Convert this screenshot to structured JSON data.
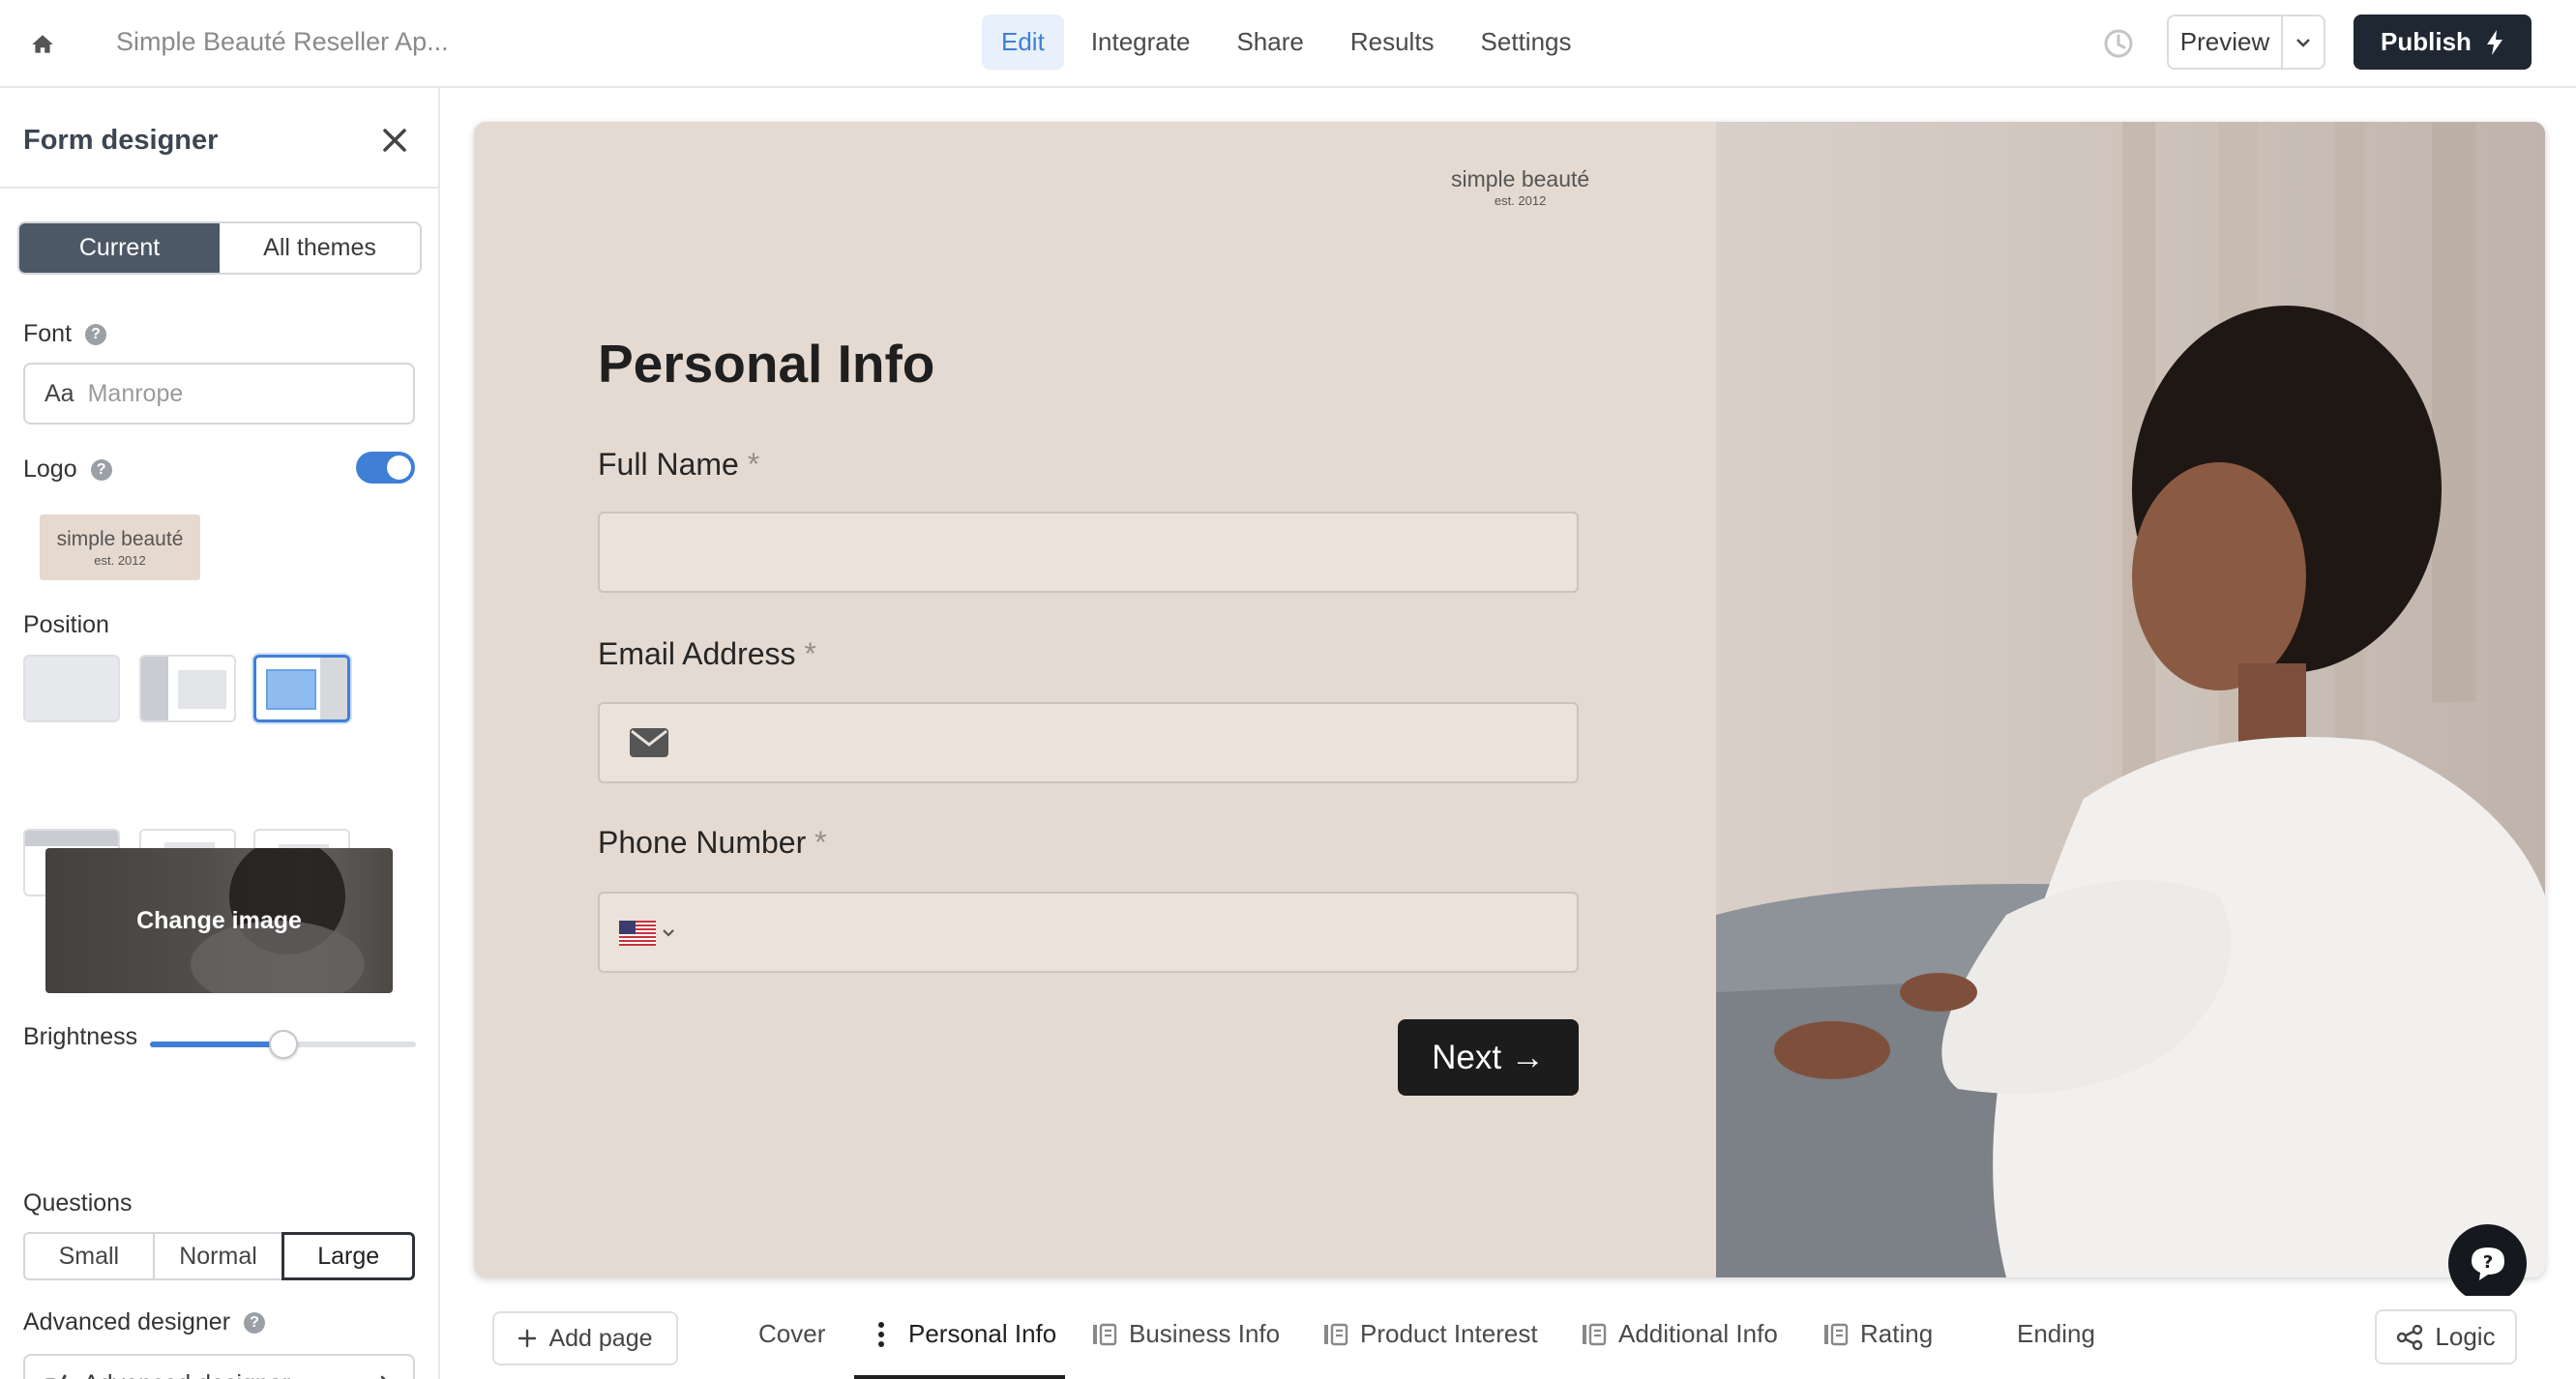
{
  "topbar": {
    "form_title": "Simple Beauté Reseller Ap...",
    "nav": [
      "Edit",
      "Integrate",
      "Share",
      "Results",
      "Settings"
    ],
    "active_nav": "Edit",
    "preview_label": "Preview",
    "publish_label": "Publish"
  },
  "sidebar": {
    "title": "Form designer",
    "theme_tabs": [
      "Current",
      "All themes"
    ],
    "font_label": "Font",
    "font_prefix": "Aa",
    "font_value": "Manrope",
    "logo_label": "Logo",
    "logo_enabled": true,
    "logo_brand": "simple beauté",
    "logo_est": "est. 2012",
    "position_label": "Position",
    "change_image_label": "Change image",
    "brightness_label": "Brightness",
    "brightness_value": 0.5,
    "questions_label": "Questions",
    "question_sizes": [
      "Small",
      "Normal",
      "Large"
    ],
    "question_size_selected": "Large",
    "advanced_label": "Advanced designer",
    "advanced_button": "Advanced designer"
  },
  "canvas": {
    "brand": "simple beauté",
    "brand_est": "est. 2012",
    "page_title": "Personal Info",
    "required_mark": "*",
    "questions": [
      {
        "label": "Full Name"
      },
      {
        "label": "Email Address"
      },
      {
        "label": "Phone Number"
      }
    ],
    "next_label": "Next →"
  },
  "bottombar": {
    "add_page": "Add page",
    "tabs": [
      "Cover",
      "Personal Info",
      "Business Info",
      "Product Interest",
      "Additional Info",
      "Rating",
      "Ending"
    ],
    "active_tab": "Personal Info",
    "logic_label": "Logic"
  },
  "colors": {
    "accent": "#3f7fd6",
    "publish_bg": "#1f2733",
    "canvas_bg": "#e5dad1",
    "field_bg": "#ebe2da"
  }
}
